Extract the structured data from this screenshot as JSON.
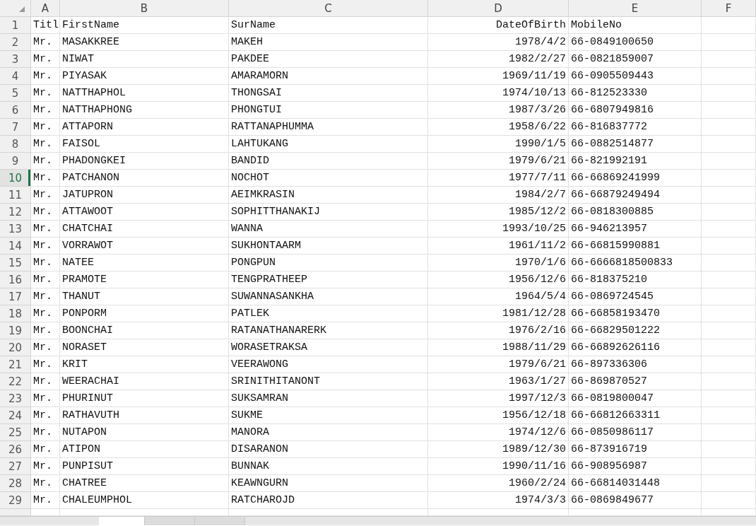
{
  "columns": [
    "A",
    "B",
    "C",
    "D",
    "E",
    "F"
  ],
  "rows": [
    {
      "number": "1",
      "selected": false,
      "cells": [
        "Titl",
        "FirstName",
        "SurName",
        "DateOfBirth",
        "MobileNo"
      ]
    },
    {
      "number": "2",
      "selected": false,
      "cells": [
        "Mr.",
        "MASAKKREE",
        "MAKEH",
        "1978/4/2",
        "66-0849100650"
      ]
    },
    {
      "number": "3",
      "selected": false,
      "cells": [
        "Mr.",
        "NIWAT",
        "PAKDEE",
        "1982/2/27",
        "66-0821859007"
      ]
    },
    {
      "number": "4",
      "selected": false,
      "cells": [
        "Mr.",
        "PIYASAK",
        "AMARAMORN",
        "1969/11/19",
        "66-0905509443"
      ]
    },
    {
      "number": "5",
      "selected": false,
      "cells": [
        "Mr.",
        "NATTHAPHOL",
        "THONGSAI",
        "1974/10/13",
        "66-812523330"
      ]
    },
    {
      "number": "6",
      "selected": false,
      "cells": [
        "Mr.",
        "NATTHAPHONG",
        "PHONGTUI",
        "1987/3/26",
        "66-6807949816"
      ]
    },
    {
      "number": "7",
      "selected": false,
      "cells": [
        "Mr.",
        "ATTAPORN",
        "RATTANAPHUMMA",
        "1958/6/22",
        "66-816837772"
      ]
    },
    {
      "number": "8",
      "selected": false,
      "cells": [
        "Mr.",
        "FAISOL",
        "LAHTUKANG",
        "1990/1/5",
        "66-0882514877"
      ]
    },
    {
      "number": "9",
      "selected": false,
      "cells": [
        "Mr.",
        "PHADONGKEI",
        "BANDID",
        "1979/6/21",
        "66-821992191"
      ]
    },
    {
      "number": "10",
      "selected": true,
      "cells": [
        "Mr.",
        "PATCHANON",
        "NOCHOT",
        "1977/7/11",
        "66-66869241999"
      ]
    },
    {
      "number": "11",
      "selected": false,
      "cells": [
        "Mr.",
        "JATUPRON",
        "AEIMKRASIN",
        "1984/2/7",
        "66-66879249494"
      ]
    },
    {
      "number": "12",
      "selected": false,
      "cells": [
        "Mr.",
        "ATTAWOOT",
        "SOPHITTHANAKIJ",
        "1985/12/2",
        "66-0818300885"
      ]
    },
    {
      "number": "13",
      "selected": false,
      "cells": [
        "Mr.",
        "CHATCHAI",
        "WANNA",
        "1993/10/25",
        "66-946213957"
      ]
    },
    {
      "number": "14",
      "selected": false,
      "cells": [
        "Mr.",
        "VORRAWOT",
        "SUKHONTAARM",
        "1961/11/2",
        "66-66815990881"
      ]
    },
    {
      "number": "15",
      "selected": false,
      "cells": [
        "Mr.",
        "NATEE",
        "PONGPUN",
        "1970/1/6",
        "66-6666818500833"
      ]
    },
    {
      "number": "16",
      "selected": false,
      "cells": [
        "Mr.",
        "PRAMOTE",
        "TENGPRATHEEP",
        "1956/12/6",
        "66-818375210"
      ]
    },
    {
      "number": "17",
      "selected": false,
      "cells": [
        "Mr.",
        "THANUT",
        "SUWANNASANKHA",
        "1964/5/4",
        "66-0869724545"
      ]
    },
    {
      "number": "18",
      "selected": false,
      "cells": [
        "Mr.",
        "PONPORM",
        "PATLEK",
        "1981/12/28",
        "66-66858193470"
      ]
    },
    {
      "number": "19",
      "selected": false,
      "cells": [
        "Mr.",
        "BOONCHAI",
        "RATANATHANARERK",
        "1976/2/16",
        "66-66829501222"
      ]
    },
    {
      "number": "20",
      "selected": false,
      "cells": [
        "Mr.",
        "NORASET",
        "WORASETRAKSA",
        "1988/11/29",
        "66-66892626116"
      ]
    },
    {
      "number": "21",
      "selected": false,
      "cells": [
        "Mr.",
        "KRIT",
        "VEERAWONG",
        "1979/6/21",
        "66-897336306"
      ]
    },
    {
      "number": "22",
      "selected": false,
      "cells": [
        "Mr.",
        "WEERACHAI",
        "SRINITHITANONT",
        "1963/1/27",
        "66-869870527"
      ]
    },
    {
      "number": "23",
      "selected": false,
      "cells": [
        "Mr.",
        "PHURINUT",
        "SUKSAMRAN",
        "1997/12/3",
        "66-0819800047"
      ]
    },
    {
      "number": "24",
      "selected": false,
      "cells": [
        "Mr.",
        "RATHAVUTH",
        "SUKME",
        "1956/12/18",
        "66-66812663311"
      ]
    },
    {
      "number": "25",
      "selected": false,
      "cells": [
        "Mr.",
        "NUTAPON",
        "MANORA",
        "1974/12/6",
        "66-0850986117"
      ]
    },
    {
      "number": "26",
      "selected": false,
      "cells": [
        "Mr.",
        "ATIPON",
        "DISARANON",
        "1989/12/30",
        "66-873916719"
      ]
    },
    {
      "number": "27",
      "selected": false,
      "cells": [
        "Mr.",
        "PUNPISUT",
        "BUNNAK",
        "1990/11/16",
        "66-908956987"
      ]
    },
    {
      "number": "28",
      "selected": false,
      "cells": [
        "Mr.",
        "CHATREE",
        "KEAWNGURN",
        "1960/2/24",
        "66-66814031448"
      ]
    },
    {
      "number": "29",
      "selected": false,
      "cells": [
        "Mr.",
        "CHALEUMPHOL",
        "RATCHAROJD",
        "1974/3/3",
        "66-0869849677"
      ]
    }
  ],
  "sheet_tabs": [
    {
      "selected": true
    },
    {
      "selected": false
    },
    {
      "selected": false
    }
  ]
}
